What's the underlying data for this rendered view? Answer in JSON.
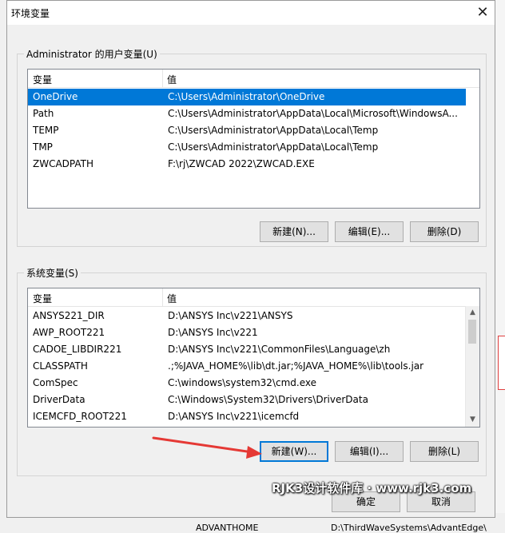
{
  "dialog": {
    "title": "环境变量",
    "close_symbol": "✕"
  },
  "user_vars": {
    "group_label": "Administrator 的用户变量(U)",
    "col_var": "变量",
    "col_val": "值",
    "rows": [
      {
        "name": "OneDrive",
        "value": "C:\\Users\\Administrator\\OneDrive"
      },
      {
        "name": "Path",
        "value": "C:\\Users\\Administrator\\AppData\\Local\\Microsoft\\WindowsA..."
      },
      {
        "name": "TEMP",
        "value": "C:\\Users\\Administrator\\AppData\\Local\\Temp"
      },
      {
        "name": "TMP",
        "value": "C:\\Users\\Administrator\\AppData\\Local\\Temp"
      },
      {
        "name": "ZWCADPATH",
        "value": "F:\\rj\\ZWCAD 2022\\ZWCAD.EXE"
      }
    ],
    "new_label": "新建(N)...",
    "edit_label": "编辑(E)...",
    "delete_label": "删除(D)"
  },
  "system_vars": {
    "group_label": "系统变量(S)",
    "col_var": "变量",
    "col_val": "值",
    "rows": [
      {
        "name": "ANSYS221_DIR",
        "value": "D:\\ANSYS Inc\\v221\\ANSYS"
      },
      {
        "name": "AWP_ROOT221",
        "value": "D:\\ANSYS Inc\\v221"
      },
      {
        "name": "CADOE_LIBDIR221",
        "value": "D:\\ANSYS Inc\\v221\\CommonFiles\\Language\\zh"
      },
      {
        "name": "CLASSPATH",
        "value": ".;%JAVA_HOME%\\lib\\dt.jar;%JAVA_HOME%\\lib\\tools.jar"
      },
      {
        "name": "ComSpec",
        "value": "C:\\windows\\system32\\cmd.exe"
      },
      {
        "name": "DriverData",
        "value": "C:\\Windows\\System32\\Drivers\\DriverData"
      },
      {
        "name": "ICEMCFD_ROOT221",
        "value": "D:\\ANSYS Inc\\v221\\icemcfd"
      }
    ],
    "new_label": "新建(W)...",
    "edit_label": "编辑(I)...",
    "delete_label": "删除(L)"
  },
  "footer": {
    "ok_label": "确定",
    "cancel_label": "取消"
  },
  "watermark": "RJK3设计软件库 · www.rjk3.com",
  "background": {
    "row_name": "ADVANTHOME",
    "row_value": "D:\\ThirdWaveSystems\\AdvantEdge\\"
  },
  "colors": {
    "selection": "#0078d7",
    "arrow": "#e53935"
  }
}
